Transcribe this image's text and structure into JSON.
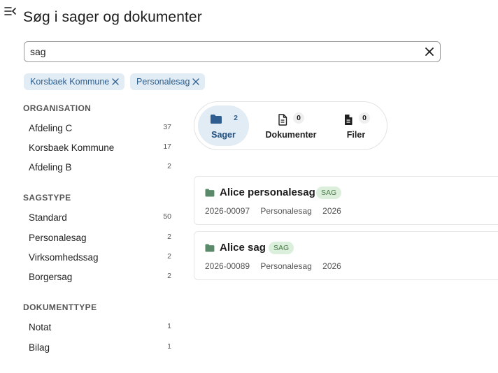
{
  "page": {
    "title": "Søg i sager og dokumenter"
  },
  "search": {
    "value": "sag",
    "placeholder": ""
  },
  "chips": [
    {
      "label": "Korsbaek Kommune"
    },
    {
      "label": "Personalesag"
    }
  ],
  "facets": {
    "organisation": {
      "heading": "ORGANISATION",
      "items": [
        {
          "label": "Afdeling C",
          "count": "37"
        },
        {
          "label": "Korsbaek Kommune",
          "count": "17"
        },
        {
          "label": "Afdeling B",
          "count": "2"
        }
      ]
    },
    "sagstype": {
      "heading": "SAGSTYPE",
      "items": [
        {
          "label": "Standard",
          "count": "50"
        },
        {
          "label": "Personalesag",
          "count": "2"
        },
        {
          "label": "Virksomhedssag",
          "count": "2"
        },
        {
          "label": "Borgersag",
          "count": "2"
        }
      ]
    },
    "dokumenttype": {
      "heading": "DOKUMENTTYPE",
      "items": [
        {
          "label": "Notat",
          "count": "1"
        },
        {
          "label": "Bilag",
          "count": "1"
        }
      ]
    }
  },
  "tabs": [
    {
      "label": "Sager",
      "count": "2",
      "icon": "folder-icon",
      "active": true
    },
    {
      "label": "Dokumenter",
      "count": "0",
      "icon": "document-outline-icon",
      "active": false
    },
    {
      "label": "Filer",
      "count": "0",
      "icon": "file-icon",
      "active": false
    }
  ],
  "results": [
    {
      "title": "Alice personalesag",
      "tag": "SAG",
      "number": "2026-00097",
      "type": "Personalesag",
      "year": "2026"
    },
    {
      "title": "Alice sag",
      "tag": "SAG",
      "number": "2026-00089",
      "type": "Personalesag",
      "year": "2026"
    }
  ],
  "colors": {
    "accent": "#2e5f8e",
    "chip_bg": "#e2ecf5",
    "folder_green": "#5b8a6b",
    "folder_blue": "#2f5d8f",
    "tag_bg": "#dcefdc",
    "tag_text": "#4b7a4b"
  }
}
